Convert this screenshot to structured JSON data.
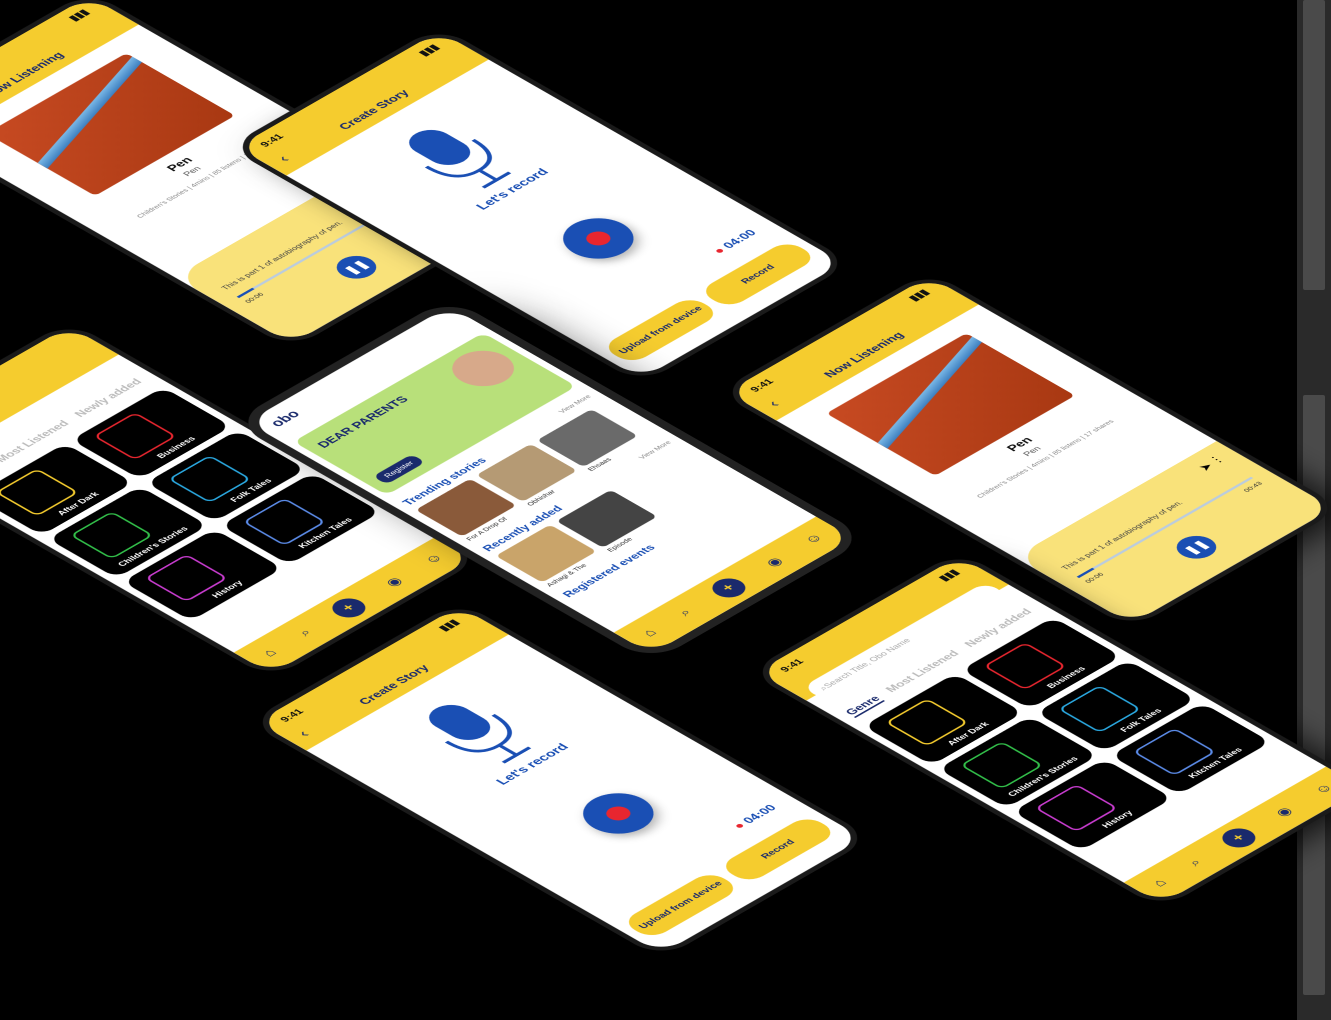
{
  "status_time": "9:41",
  "create_story": {
    "title": "Create Story",
    "prompt": "Let's record",
    "timer": "04:00",
    "upload_label": "Upload from device",
    "record_label": "Record"
  },
  "now_listening": {
    "title": "Now Listening",
    "story_name": "Pen",
    "author": "Pen",
    "stats": "Children's Stories | 4mins | 85 listens | 17 shares",
    "description": "This is part 1 of autobiography of pen.",
    "time_start": "00:06",
    "time_end": "00:43"
  },
  "genre": {
    "search_placeholder": "Search Title, Obo Name",
    "tabs": [
      "Genre",
      "Most Listened",
      "Newly added"
    ],
    "tiles": [
      {
        "label": "After Dark",
        "color": "#f5cc2e"
      },
      {
        "label": "Business",
        "color": "#e8262f"
      },
      {
        "label": "Children's Stories",
        "color": "#32c04a"
      },
      {
        "label": "Folk Tales",
        "color": "#2aa8e0"
      },
      {
        "label": "History",
        "color": "#c93cd0"
      },
      {
        "label": "Kitchen Tales",
        "color": "#5b8be8"
      }
    ]
  },
  "home": {
    "logo": "obo",
    "banner_title": "DEAR PARENTS",
    "register_label": "Register",
    "trending_label": "Trending stories",
    "recently_label": "Recently added",
    "events_label": "Registered events",
    "view_more": "View More",
    "trending_cards": [
      "For A Drop Of",
      "Obhishar",
      "Ehsaas"
    ],
    "recent_cards": [
      "Ashagi & The",
      "Episode"
    ]
  },
  "colors": {
    "accent": "#f5cc2e",
    "primary": "#1a4fb4",
    "record": "#e8262f"
  }
}
